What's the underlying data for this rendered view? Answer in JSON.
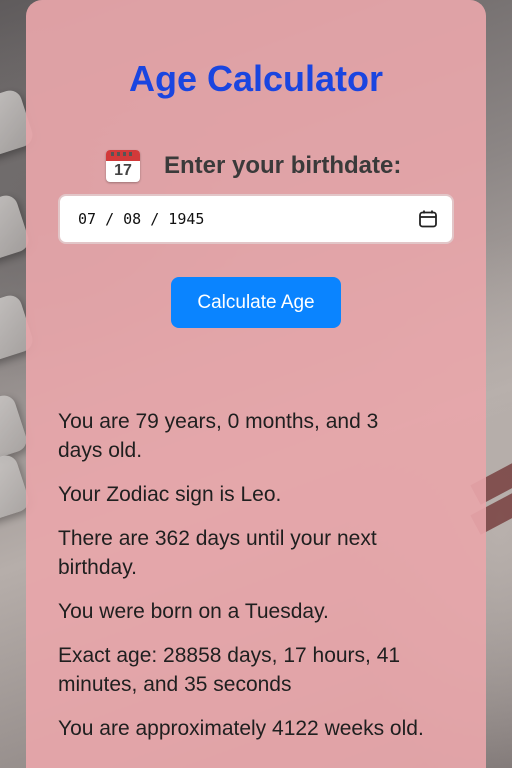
{
  "app": {
    "title": "Age Calculator"
  },
  "form": {
    "icon_day": "17",
    "label": "Enter your birthdate:",
    "date_value": "07 / 08 / 1945",
    "button_label": "Calculate Age"
  },
  "results": [
    "You are 79 years, 0 months, and 3 days old.",
    "Your Zodiac sign is Leo.",
    "There are 362 days until your next birthday.",
    "You were born on a Tuesday.",
    "Exact age: 28858 days, 17 hours, 41 minutes, and 35 seconds",
    "You are approximately 4122 weeks old."
  ],
  "colors": {
    "title": "#1a45e0",
    "card": "#e8a6aa",
    "button": "#0a84ff",
    "text": "#1f1f1f"
  },
  "icons": {
    "label_icon": "calendar-icon",
    "picker_icon": "calendar-picker-icon"
  }
}
